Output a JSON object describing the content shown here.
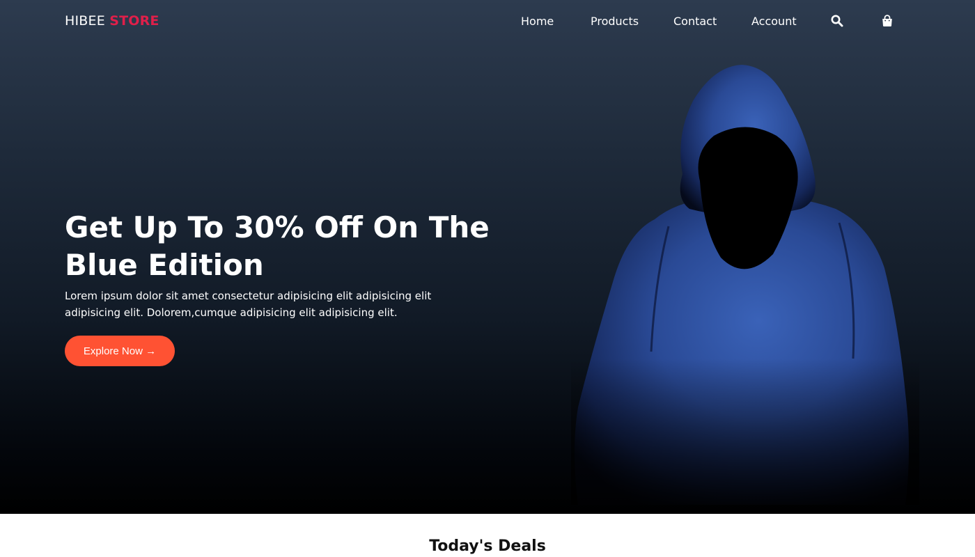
{
  "brand": {
    "part1": "HIBEE",
    "part2": "STORE",
    "accent_color": "#e01f4a"
  },
  "nav": {
    "items": [
      {
        "label": "Home"
      },
      {
        "label": "Products"
      },
      {
        "label": "Contact"
      },
      {
        "label": "Account"
      }
    ],
    "icons": [
      "search-icon",
      "shopping-bag-icon"
    ]
  },
  "hero": {
    "title": "Get Up To 30% Off On The Blue Edition",
    "text": "Lorem ipsum dolor sit amet consectetur adipisicing elit adipisicing elit adipisicing elit. Dolorem,cumque adipisicing elit adipisicing elit.",
    "button_label": "Explore Now →",
    "button_color": "#ff5233",
    "image": "hooded-figure-blue-hoodie"
  },
  "deals": {
    "title": "Today's Deals"
  }
}
